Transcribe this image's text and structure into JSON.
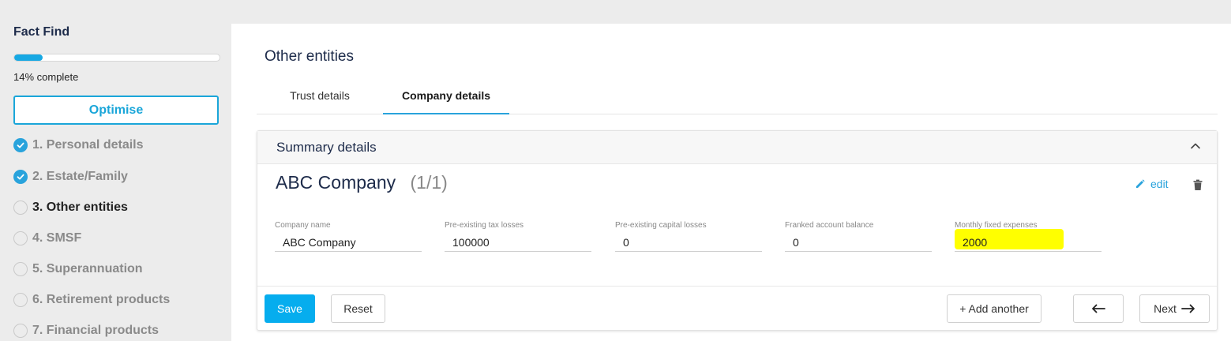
{
  "sidebar": {
    "title": "Fact Find",
    "progress_percent": 14,
    "progress_text": "14% complete",
    "optimise_label": "Optimise",
    "steps": [
      {
        "label": "1. Personal details",
        "status": "done"
      },
      {
        "label": "2. Estate/Family",
        "status": "done"
      },
      {
        "label": "3. Other entities",
        "status": "current"
      },
      {
        "label": "4. SMSF",
        "status": "todo"
      },
      {
        "label": "5. Superannuation",
        "status": "todo"
      },
      {
        "label": "6. Retirement products",
        "status": "todo"
      },
      {
        "label": "7. Financial products",
        "status": "todo"
      }
    ]
  },
  "main": {
    "title": "Other entities",
    "tabs": [
      {
        "label": "Trust details",
        "selected": false
      },
      {
        "label": "Company details",
        "selected": true
      }
    ],
    "panel": {
      "header": "Summary details",
      "company_name": "ABC Company",
      "company_count": "(1/1)",
      "edit_label": "edit",
      "fields": [
        {
          "label": "Company name",
          "value": "ABC Company"
        },
        {
          "label": "Pre-existing tax losses",
          "value": "100000"
        },
        {
          "label": "Pre-existing capital losses",
          "value": "0"
        },
        {
          "label": "Franked account balance",
          "value": "0"
        },
        {
          "label": "Monthly fixed expenses",
          "value": "2000",
          "highlighted": true
        }
      ],
      "footer": {
        "save_label": "Save",
        "reset_label": "Reset",
        "add_another_label": "+ Add another",
        "back_icon": "arrow-left-icon",
        "next_label": "Next",
        "next_icon": "arrow-right-icon"
      }
    }
  },
  "colors": {
    "accent": "#29a3dc",
    "primary_button": "#06adee",
    "highlight": "#ffff00",
    "heading": "#1d2b4a"
  }
}
